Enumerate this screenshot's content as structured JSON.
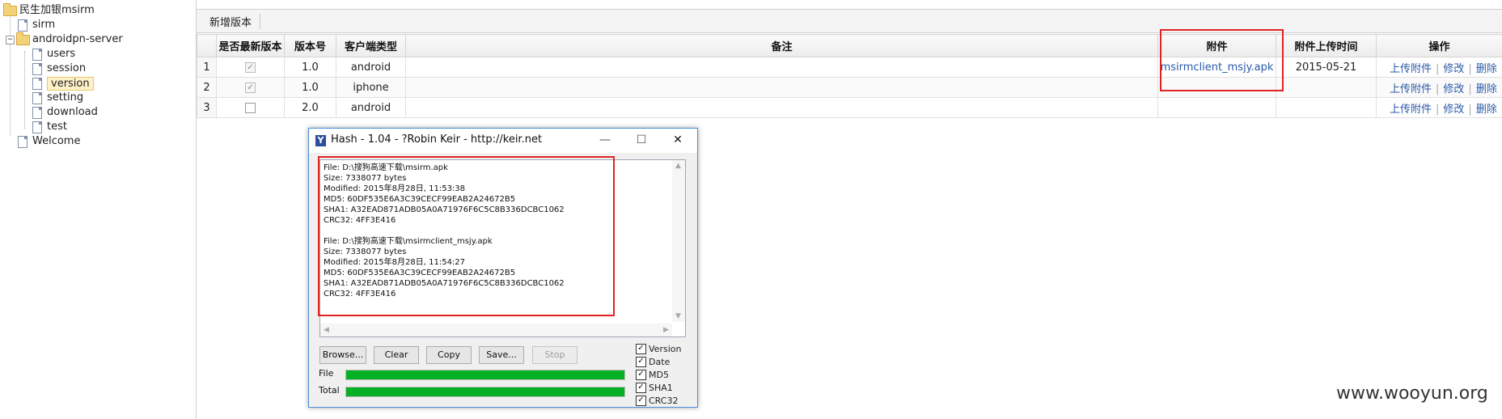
{
  "tree": {
    "root": "民生加银msirm",
    "items": [
      "sirm"
    ],
    "group": "androidpn-server",
    "children": [
      "users",
      "session",
      "version",
      "setting",
      "download",
      "test"
    ],
    "selected": "version",
    "welcome": "Welcome",
    "expander_symbol": "−"
  },
  "toolbar": {
    "add_label": "新增版本"
  },
  "grid": {
    "headers": [
      "是否最新版本",
      "版本号",
      "客户端类型",
      "备注",
      "附件",
      "附件上传时间",
      "操作"
    ],
    "rows": [
      {
        "num": "1",
        "latest": "checked-disabled",
        "version": "1.0",
        "client": "android",
        "note": "",
        "attachment": "msirmclient_msjy.apk",
        "upload_time": "2015-05-21"
      },
      {
        "num": "2",
        "latest": "checked-disabled",
        "version": "1.0",
        "client": "iphone",
        "note": "",
        "attachment": "",
        "upload_time": ""
      },
      {
        "num": "3",
        "latest": "unchecked",
        "version": "2.0",
        "client": "android",
        "note": "",
        "attachment": "",
        "upload_time": ""
      }
    ],
    "actions": {
      "upload": "上传附件",
      "edit": "修改",
      "delete": "删除",
      "separator": "|"
    }
  },
  "hash_window": {
    "title": "Hash - 1.04 - ?Robin Keir - http://keir.net",
    "controls": {
      "minimize": "—",
      "maximize": "☐",
      "close": "✕"
    },
    "output_lines": [
      "File: D:\\搜狗高速下载\\msirm.apk",
      "Size: 7338077 bytes",
      "Modified: 2015年8月28日, 11:53:38",
      "MD5: 60DF535E6A3C39CECF99EAB2A24672B5",
      "SHA1: A32EAD871ADB05A0A71976F6C5C8B336DCBC1062",
      "CRC32: 4FF3E416",
      "",
      "File: D:\\搜狗高速下载\\msirmclient_msjy.apk",
      "Size: 7338077 bytes",
      "Modified: 2015年8月28日, 11:54:27",
      "MD5: 60DF535E6A3C39CECF99EAB2A24672B5",
      "SHA1: A32EAD871ADB05A0A71976F6C5C8B336DCBC1062",
      "CRC32: 4FF3E416"
    ],
    "buttons": {
      "browse": "Browse...",
      "clear": "Clear",
      "copy": "Copy",
      "save": "Save...",
      "stop": "Stop"
    },
    "options": [
      {
        "label": "Version",
        "checked": true
      },
      {
        "label": "Date",
        "checked": true
      },
      {
        "label": "MD5",
        "checked": true
      },
      {
        "label": "SHA1",
        "checked": true
      },
      {
        "label": "CRC32",
        "checked": true
      }
    ],
    "progress": [
      {
        "label": "File",
        "percent": 100
      },
      {
        "label": "Total",
        "percent": 100
      }
    ],
    "progress_color": "#06b025"
  },
  "highlight_color": "#e02424",
  "watermark": "www.wooyun.org"
}
